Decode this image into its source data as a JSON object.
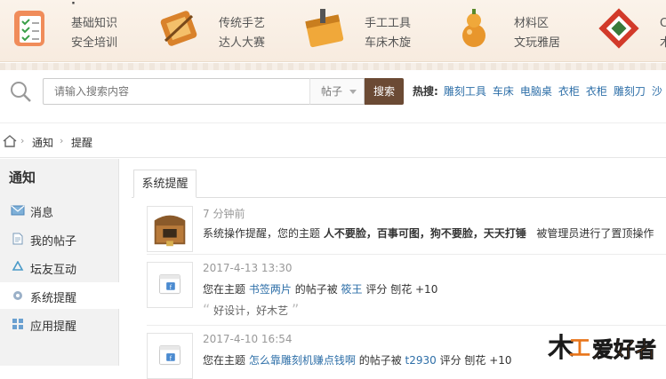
{
  "categories": [
    {
      "icon": "checklist-icon",
      "lines": [
        "基础知识",
        "安全培训"
      ]
    },
    {
      "icon": "craft-tools-icon",
      "lines": [
        "传统手艺",
        "达人大赛"
      ]
    },
    {
      "icon": "toolbox-icon",
      "lines": [
        "手工工具",
        "车床木旋"
      ]
    },
    {
      "icon": "gourd-icon",
      "lines": [
        "材料区",
        "文玩雅居"
      ]
    },
    {
      "icon": "tablet-icon",
      "lines": [
        "C",
        "木"
      ]
    }
  ],
  "search": {
    "placeholder": "请输入搜索内容",
    "scope": "帖子",
    "button": "搜索",
    "hot_label": "热搜:",
    "hot_terms": [
      "雕刻工具",
      "车床",
      "电脑桌",
      "衣柜",
      "衣柜",
      "雕刻刀",
      "沙"
    ]
  },
  "breadcrumb": {
    "items": [
      "通知",
      "提醒"
    ],
    "separator": "›"
  },
  "sidebar": {
    "title": "通知",
    "items": [
      {
        "label": "消息",
        "icon": "envelope-icon"
      },
      {
        "label": "我的帖子",
        "icon": "document-icon"
      },
      {
        "label": "坛友互动",
        "icon": "recycle-icon"
      },
      {
        "label": "系统提醒",
        "icon": "gear-icon",
        "active": true
      },
      {
        "label": "应用提醒",
        "icon": "grid-icon"
      }
    ]
  },
  "tab": {
    "label": "系统提醒"
  },
  "notices": [
    {
      "time": "7 分钟前",
      "text_pre": "系统操作提醒，您的主题",
      "subject": "人不要脸，百事可图，狗不要脸，天天打锤",
      "text_post": "被管理员进行了置顶操作"
    },
    {
      "time": "2017-4-13 13:30",
      "text_pre": "您在主题",
      "subject": "书签两片",
      "mid": "的帖子被",
      "user": "筱王",
      "rate": "评分 刨花 +10",
      "quote": "好设计，好木艺"
    },
    {
      "time": "2017-4-10 16:54",
      "text_pre": "您在主题",
      "subject": "怎么靠雕刻机赚点钱啊",
      "mid": "的帖子被",
      "user": "t2930",
      "rate": "评分 刨花 +10"
    }
  ],
  "logo": {
    "text": "爱好者"
  },
  "colors": {
    "link": "#2e6fa8",
    "button": "#6b4a34",
    "logo_orange": "#e8751a"
  }
}
